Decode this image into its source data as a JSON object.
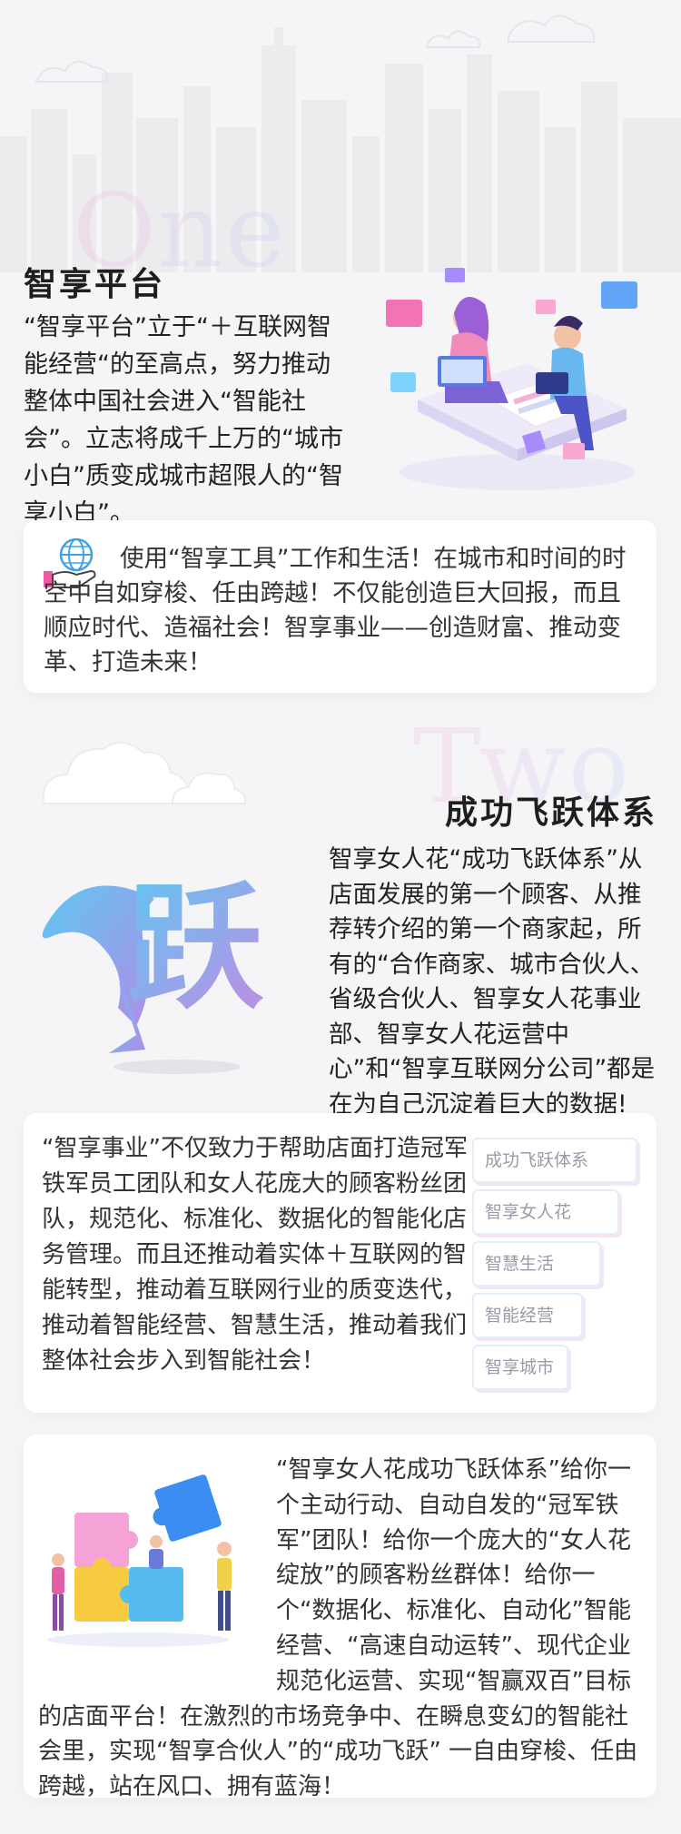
{
  "colors": {
    "background": "#f5f5f7",
    "card": "#ffffff",
    "tag_text": "#9a9aaa"
  },
  "section1": {
    "ghost_word": "One",
    "title": "智享平台",
    "intro": "“智享平台”立于“＋互联网智能经营“的至高点，努力推动整体中国社会进入“智能社会”。立志将成千上万的“城市小白”质变成城市超限人的“智享小白”。",
    "card_text": "使用“智享工具”工作和生活！在城市和时间的时空中自如穿梭、任由跨越！不仅能创造巨大回报，而且顺应时代、造福社会！智享事业——创造财富、推动变革、打造未来！",
    "card_icon": "globe-hand-icon"
  },
  "section2": {
    "ghost_word": "Two",
    "title": "成功飞跃体系",
    "logo_text": "跃",
    "description": "智享女人花“成功飞跃体系”从店面发展的第一个顾客、从推荐转介绍的第一个商家起，所有的“合作商家、城市合伙人、省级合伙人、智享女人花事业部、智享女人花运营中心”和“智享互联网分公司”都是在为自己沉淀着巨大的数据!",
    "card_text": "“智享事业”不仅致力于帮助店面打造冠军铁军员工团队和女人花庞大的顾客粉丝团队，规范化、标准化、数据化的智能化店务管理。而且还推动着实体＋互联网的智能转型，推动着互联网行业的质变迭代，推动着智能经营、智慧生活，推动着我们整体社会步入到智能社会！",
    "tags": [
      "成功飞跃体系",
      "智享女人花",
      "智慧生活",
      "智能经营",
      "智享城市"
    ]
  },
  "section3": {
    "card_text": "“智享女人花成功飞跃体系”给你一个主动行动、自动自发的“冠军铁军”团队！给你一个庞大的“女人花绽放”的顾客粉丝群体！给你一个“数据化、标准化、自动化”智能经营、“高速自动运转”、现代企业规范化运营、实现“智赢双百”目标的店面平台！在激烈的市场竞争中、在瞬息变幻的智能社会里，实现“智享合伙人”的“成功飞跃” 一自由穿梭、任由跨越，站在风口、拥有蓝海！"
  }
}
